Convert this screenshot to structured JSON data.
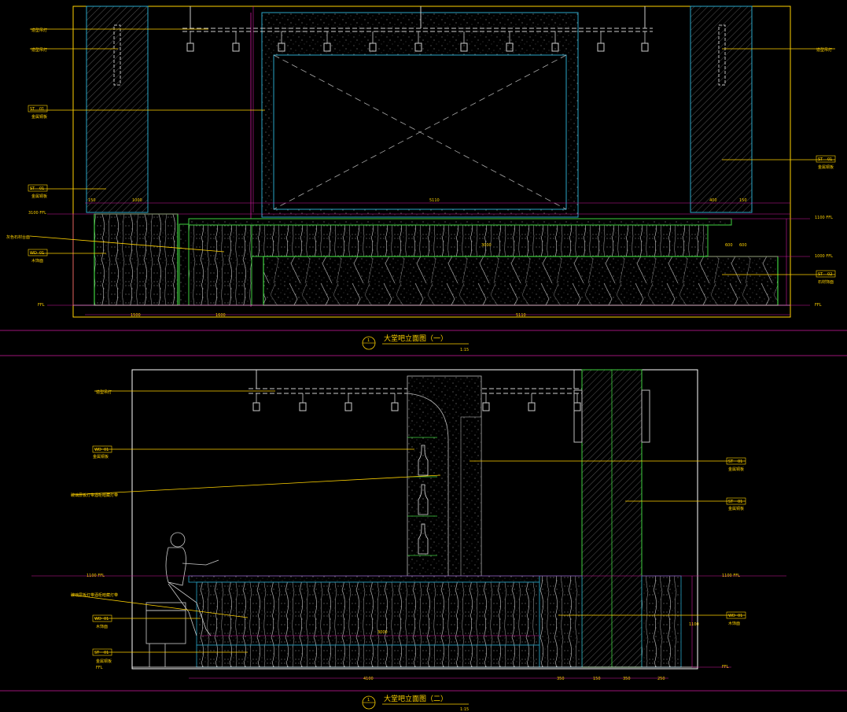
{
  "drawing_1": {
    "title": "大堂吧立面图（一）",
    "scale": "1:15",
    "number": "1",
    "labels_left": [
      "造型吊灯",
      "造型吊灯",
      "金属铜板",
      "金属铜板",
      "木饰面",
      "灰色石材台面"
    ],
    "tags_left": [
      [
        "ST",
        "01"
      ],
      [
        "ST",
        "01"
      ],
      [
        "WD",
        "01"
      ]
    ],
    "labels_right": [
      "造型吊灯",
      "金属铜板",
      "石材饰面"
    ],
    "tags_right": [
      [
        "ST",
        "01"
      ],
      [
        "ST",
        "02"
      ]
    ],
    "levels": [
      "1100 FFL",
      "1000 FFL",
      "FFL",
      "3100 FFL",
      "FFL"
    ],
    "dims_top": [
      "150",
      "1000",
      "5110",
      "400",
      "150"
    ],
    "dims_bottom": [
      "1500",
      "1600",
      "5110"
    ],
    "dims_mid": [
      "3000",
      "600",
      "600",
      "1200",
      "2000"
    ]
  },
  "drawing_2": {
    "title": "大堂吧立面图（二）",
    "scale": "1:15",
    "number": "1",
    "labels_left": [
      "造型吊灯",
      "金属铜板",
      "玻璃层板灯带酒柜暗藏灯带",
      "玻璃层板灯带酒柜暗藏灯带",
      "木饰面",
      "金属铜板"
    ],
    "tags_left": [
      [
        "WD",
        "01"
      ],
      [
        "WD",
        "01"
      ],
      [
        "ST",
        "01"
      ]
    ],
    "labels_right": [
      "金属铜板",
      "金属铜板",
      "木饰面"
    ],
    "tags_right": [
      [
        "ST",
        "01"
      ],
      [
        "ST",
        "01"
      ],
      [
        "WD",
        "01"
      ]
    ],
    "levels": [
      "1100 FFL",
      "1100 FFL",
      "FFL",
      "FFL"
    ],
    "dims_bottom": [
      "4100",
      "350",
      "150",
      "350",
      "250"
    ],
    "dims_mid": [
      "3000",
      "1100"
    ]
  }
}
